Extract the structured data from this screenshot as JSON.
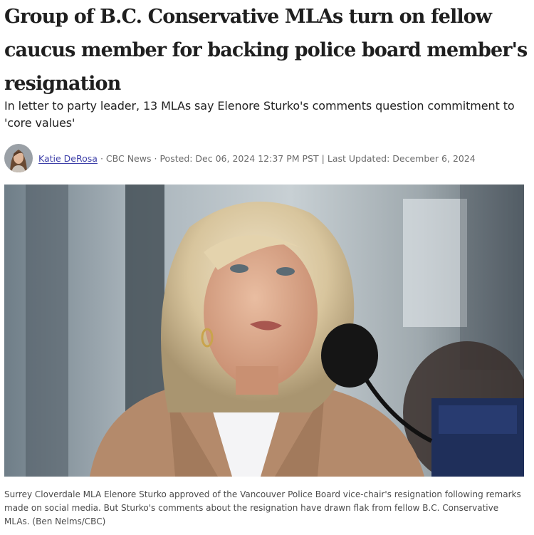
{
  "article": {
    "headline": "Group of B.C. Conservative MLAs turn on fellow caucus member for backing police board member's resignation",
    "deck": "In letter to party leader, 13 MLAs say Elenore Sturko's comments question commitment to 'core values'"
  },
  "byline": {
    "author": "Katie DeRosa",
    "outlet": "CBC News",
    "posted": "Posted: Dec 06, 2024 12:37 PM PST",
    "separator": "|",
    "updated": "Last Updated: December 6, 2024",
    "dot": "·"
  },
  "photo": {
    "caption": "Surrey Cloverdale MLA Elenore Sturko approved of the Vancouver Police Board vice-chair's resignation following remarks made on social media. But Sturko's comments about the resignation have drawn flak from fellow B.C. Conservative MLAs. (Ben Nelms/CBC)"
  }
}
